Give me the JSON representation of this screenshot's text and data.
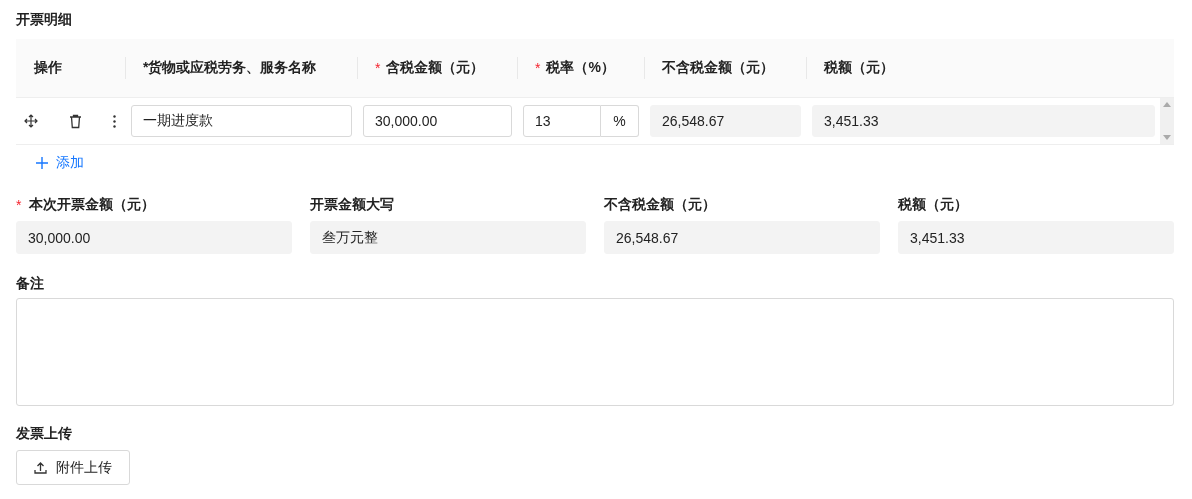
{
  "section_title": "开票明细",
  "table": {
    "columns": [
      {
        "label": "操作"
      },
      {
        "label": "*货物或应税劳务、服务名称"
      },
      {
        "mark": "*",
        "label": "含税金额（元）"
      },
      {
        "mark": "*",
        "label": "税率（%）"
      },
      {
        "label": "不含税金额（元）"
      },
      {
        "label": "税额（元）"
      }
    ],
    "rows": [
      {
        "name": "一期进度款",
        "amount": "30,000.00",
        "rate": "13",
        "rate_unit": "%",
        "net": "26,548.67",
        "tax": "3,451.33"
      }
    ]
  },
  "add_button": {
    "label": "添加"
  },
  "summary": [
    {
      "mark": "*",
      "label": "本次开票金额（元）",
      "value": "30,000.00"
    },
    {
      "label": "开票金额大写",
      "value": "叁万元整"
    },
    {
      "label": "不含税金额（元）",
      "value": "26,548.67"
    },
    {
      "label": "税额（元）",
      "value": "3,451.33"
    }
  ],
  "remarks": {
    "label": "备注"
  },
  "upload": {
    "label": "发票上传",
    "button": "附件上传"
  }
}
